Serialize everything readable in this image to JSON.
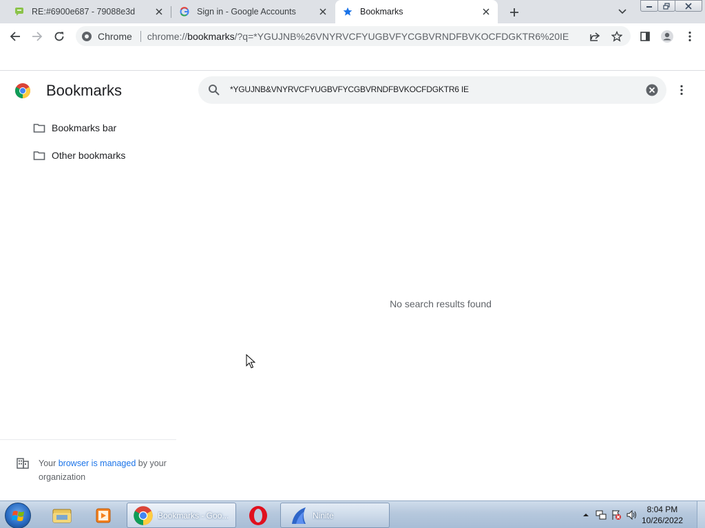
{
  "browser": {
    "tabs": [
      {
        "title": "RE:#6900e687 - 79088e3d",
        "icon": "message-icon",
        "active": false
      },
      {
        "title": "Sign in - Google Accounts",
        "icon": "google-g-icon",
        "active": false
      },
      {
        "title": "Bookmarks",
        "icon": "star-icon",
        "active": true
      }
    ],
    "address_bar": {
      "site_label": "Chrome",
      "url_prefix": "chrome://",
      "url_host": "bookmarks",
      "url_rest": "/?q=*YGUJNB%26VNYRVCFYUGBVFYCGBVRNDFBVKOCFDGKTR6%20IE"
    }
  },
  "bookmarks_page": {
    "title": "Bookmarks",
    "search": {
      "value": "*YGUJNB&VNYRVCFYUGBVFYCGBVRNDFBVKOCFDGKTR6 IE"
    },
    "folders": [
      {
        "label": "Bookmarks bar"
      },
      {
        "label": "Other bookmarks"
      }
    ],
    "empty_message": "No search results found",
    "managed": {
      "prefix": "Your ",
      "link": "browser is managed",
      "suffix": " by your organization"
    }
  },
  "taskbar": {
    "items": [
      {
        "label": "",
        "icon": "explorer-icon"
      },
      {
        "label": "",
        "icon": "media-player-icon"
      },
      {
        "label": "Bookmarks - Goo...",
        "icon": "chrome-icon"
      },
      {
        "label": "",
        "icon": "opera-icon"
      },
      {
        "label": "Ninite",
        "icon": "ninite-icon"
      }
    ],
    "clock": {
      "time": "8:04 PM",
      "date": "10/26/2022"
    }
  },
  "colors": {
    "accent": "#1a73e8",
    "tabstrip": "#dee1e6",
    "taskbar": "#b6c8dd"
  }
}
